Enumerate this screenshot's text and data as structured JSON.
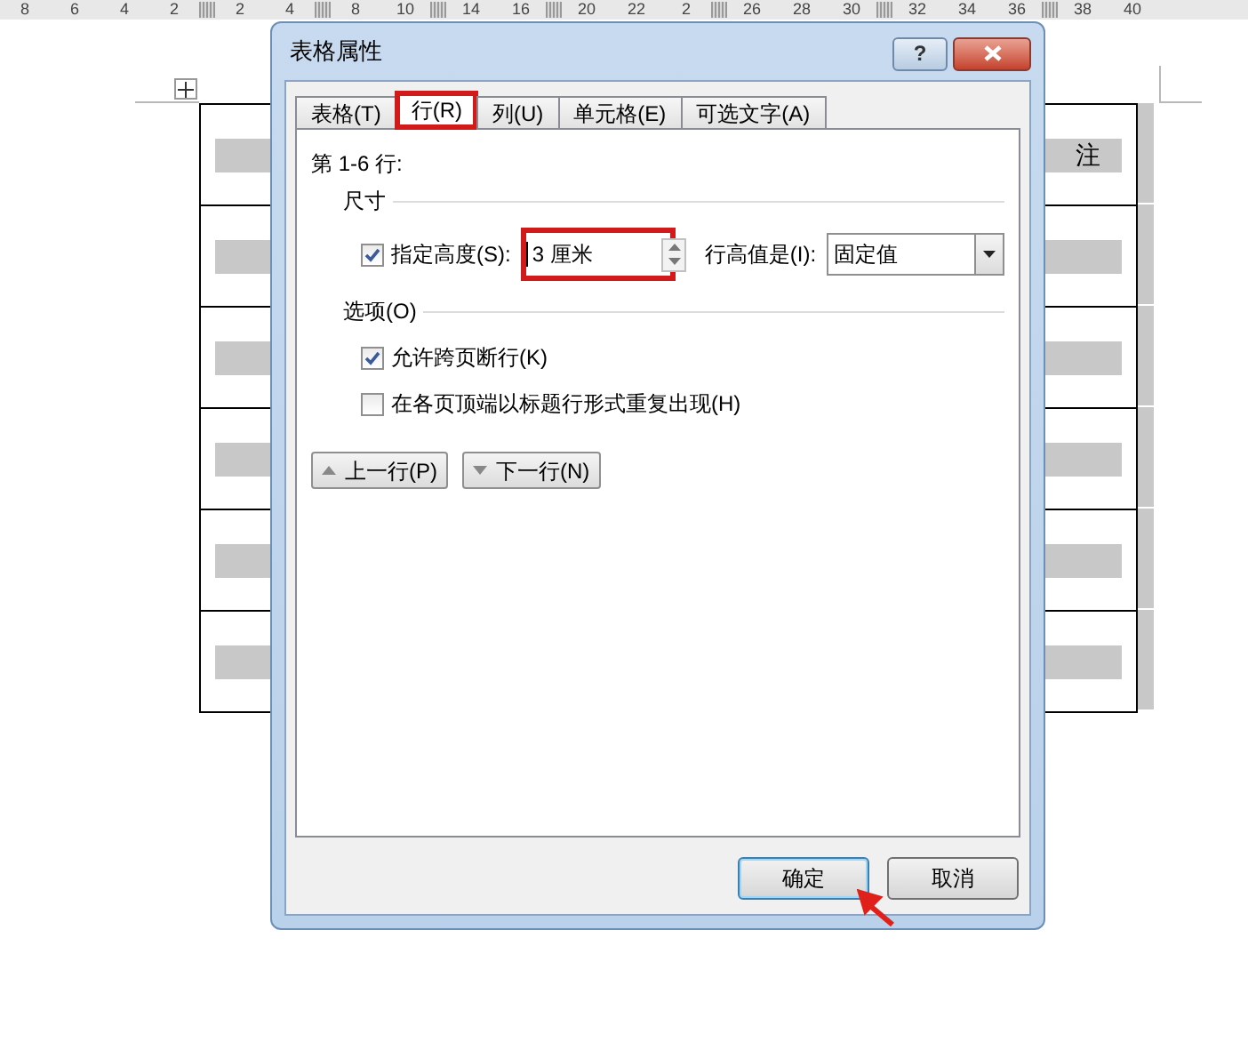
{
  "ruler": {
    "items": [
      {
        "kind": "label",
        "text": "8"
      },
      {
        "kind": "label",
        "text": "6"
      },
      {
        "kind": "label",
        "text": "4"
      },
      {
        "kind": "label",
        "text": "2"
      },
      {
        "kind": "marker"
      },
      {
        "kind": "label",
        "text": "2"
      },
      {
        "kind": "label",
        "text": "4"
      },
      {
        "kind": "marker"
      },
      {
        "kind": "label",
        "text": "8"
      },
      {
        "kind": "label",
        "text": "10"
      },
      {
        "kind": "marker"
      },
      {
        "kind": "label",
        "text": "14"
      },
      {
        "kind": "label",
        "text": "16"
      },
      {
        "kind": "marker"
      },
      {
        "kind": "label",
        "text": "20"
      },
      {
        "kind": "label",
        "text": "22"
      },
      {
        "kind": "label",
        "text": "2"
      },
      {
        "kind": "marker"
      },
      {
        "kind": "label",
        "text": "26"
      },
      {
        "kind": "label",
        "text": "28"
      },
      {
        "kind": "label",
        "text": "30"
      },
      {
        "kind": "marker"
      },
      {
        "kind": "label",
        "text": "32"
      },
      {
        "kind": "label",
        "text": "34"
      },
      {
        "kind": "label",
        "text": "36"
      },
      {
        "kind": "marker"
      },
      {
        "kind": "label",
        "text": "38"
      },
      {
        "kind": "label",
        "text": "40"
      }
    ]
  },
  "table": {
    "header_text": "注"
  },
  "dialog": {
    "title": "表格属性",
    "help": "?",
    "tabs": [
      {
        "label": "表格(T)",
        "selected": false,
        "highlighted": false
      },
      {
        "label": "行(R)",
        "selected": true,
        "highlighted": true
      },
      {
        "label": "列(U)",
        "selected": false,
        "highlighted": false
      },
      {
        "label": "单元格(E)",
        "selected": false,
        "highlighted": false
      },
      {
        "label": "可选文字(A)",
        "selected": false,
        "highlighted": false
      }
    ],
    "rows_label": "第 1-6 行:",
    "size_section": "尺寸",
    "height": {
      "label": "指定高度(S):",
      "checked": true,
      "value": "3 厘米",
      "highlighted": true
    },
    "rule": {
      "label": "行高值是(I):",
      "value": "固定值"
    },
    "options_section": "选项(O)",
    "options": [
      {
        "label": "允许跨页断行(K)",
        "checked": true
      },
      {
        "label": "在各页顶端以标题行形式重复出现(H)",
        "checked": false
      }
    ],
    "nav_buttons": [
      {
        "label": "上一行(P)",
        "kind": "up"
      },
      {
        "label": "下一行(N)",
        "kind": "down"
      }
    ],
    "buttons": [
      {
        "label": "确定",
        "kind": "default"
      },
      {
        "label": "取消",
        "kind": "normal"
      }
    ]
  }
}
